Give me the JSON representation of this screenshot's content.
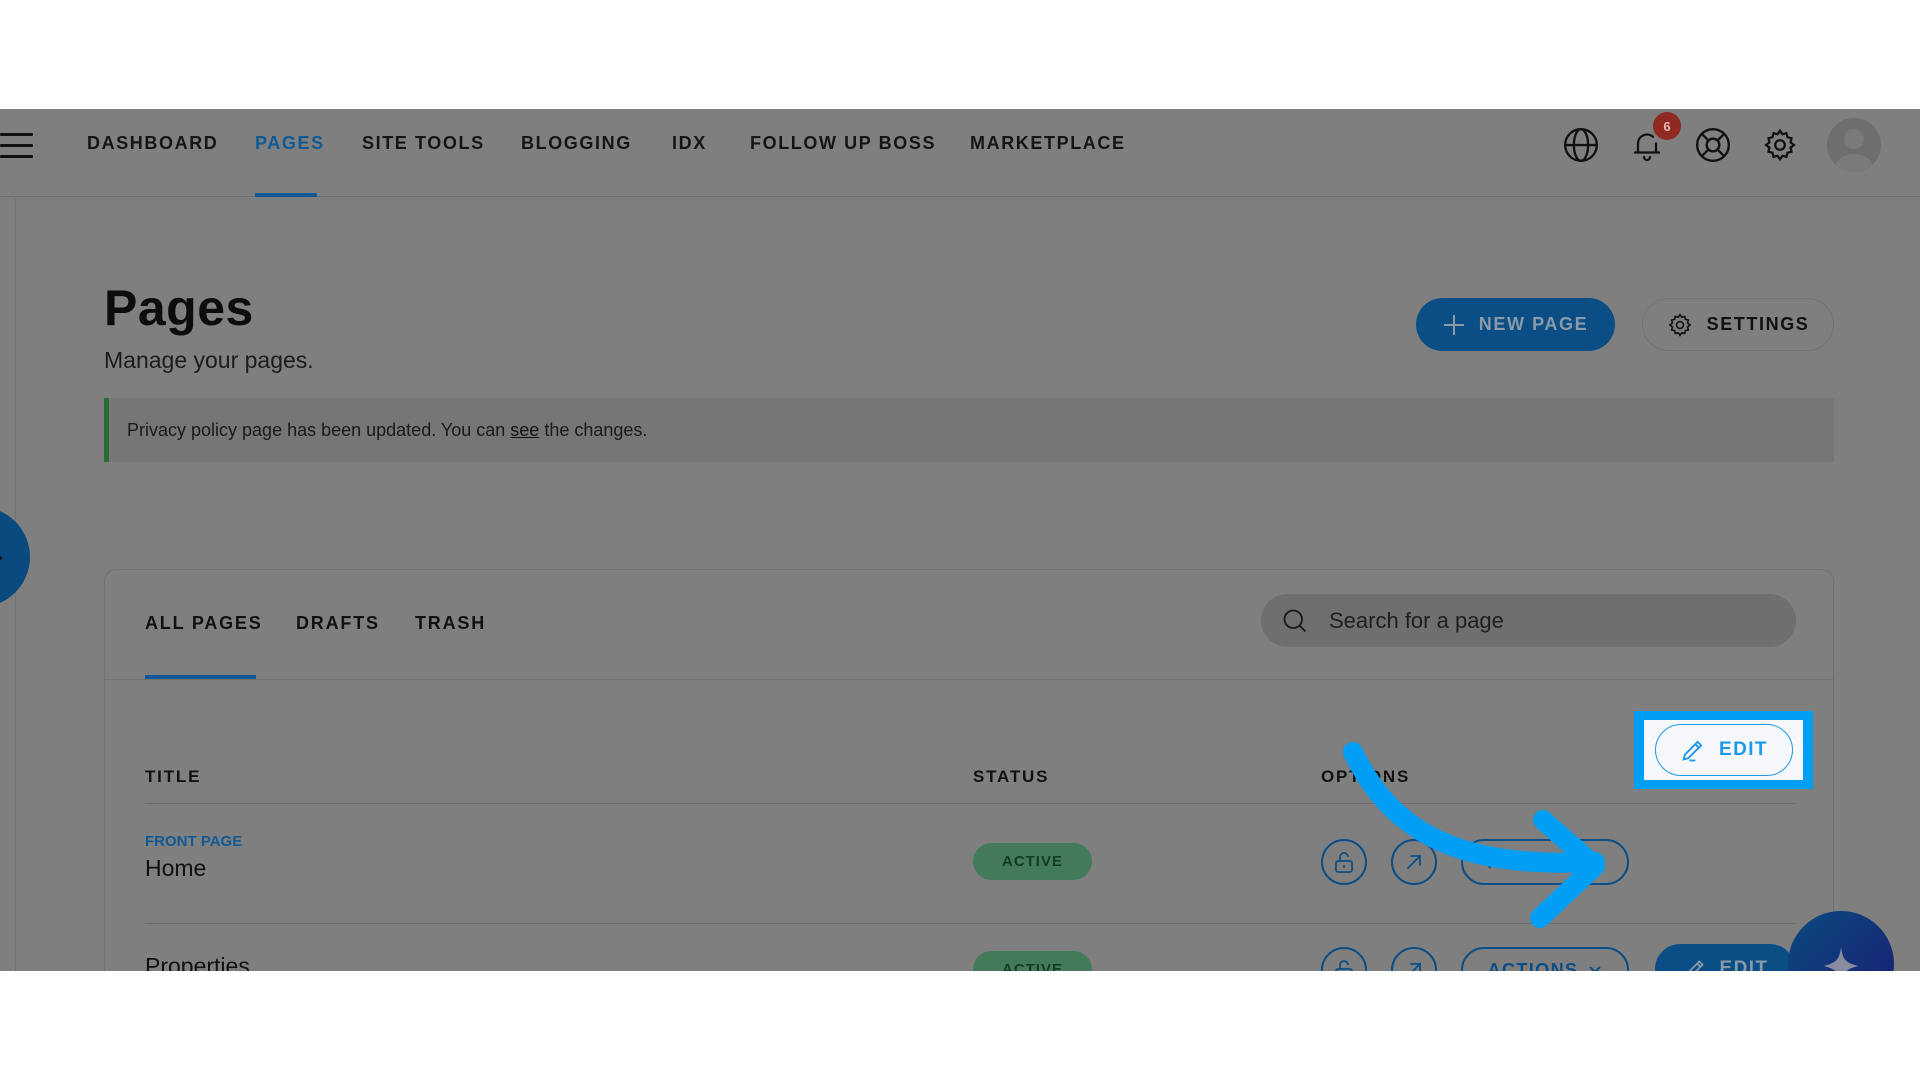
{
  "nav": {
    "menu_icon": "hamburger-menu-icon",
    "items": [
      {
        "label": "DASHBOARD",
        "active": false
      },
      {
        "label": "PAGES",
        "active": true
      },
      {
        "label": "SITE TOOLS",
        "active": false
      },
      {
        "label": "BLOGGING",
        "active": false
      },
      {
        "label": "IDX",
        "active": false
      },
      {
        "label": "FOLLOW UP BOSS",
        "active": false
      },
      {
        "label": "MARKETPLACE",
        "active": false
      }
    ],
    "icons": [
      "globe-icon",
      "bell-icon",
      "lifebuoy-icon",
      "gear-icon",
      "avatar"
    ],
    "notification_count": "6"
  },
  "header": {
    "title": "Pages",
    "subtitle": "Manage your pages.",
    "new_page_label": "NEW PAGE",
    "settings_label": "SETTINGS"
  },
  "notice": {
    "text_before": "Privacy policy page has been updated. You can",
    "link_text": "see",
    "text_after": "the changes.",
    "accent_color": "#276b35"
  },
  "tabs": [
    {
      "label": "ALL PAGES",
      "active": true
    },
    {
      "label": "DRAFTS",
      "active": false
    },
    {
      "label": "TRASH",
      "active": false
    }
  ],
  "search": {
    "placeholder": "Search for a page",
    "value": ""
  },
  "table": {
    "columns": [
      "TITLE",
      "STATUS",
      "OPTIONS"
    ],
    "rows": [
      {
        "kicker": "FRONT PAGE",
        "title": "Home",
        "status": "ACTIVE",
        "actions_label": "ACTIONS",
        "edit_label": "EDIT"
      },
      {
        "kicker": "",
        "title": "Properties",
        "status": "ACTIVE",
        "actions_label": "ACTIONS",
        "edit_label": "EDIT"
      }
    ]
  },
  "annotation": {
    "highlight_target": "EDIT",
    "highlight_color": "#009ff5"
  },
  "colors": {
    "brand": "#0b4e85",
    "active_nav": "#0f5a96",
    "status_active_bg": "#437b5a",
    "badge": "#8e2a22"
  }
}
